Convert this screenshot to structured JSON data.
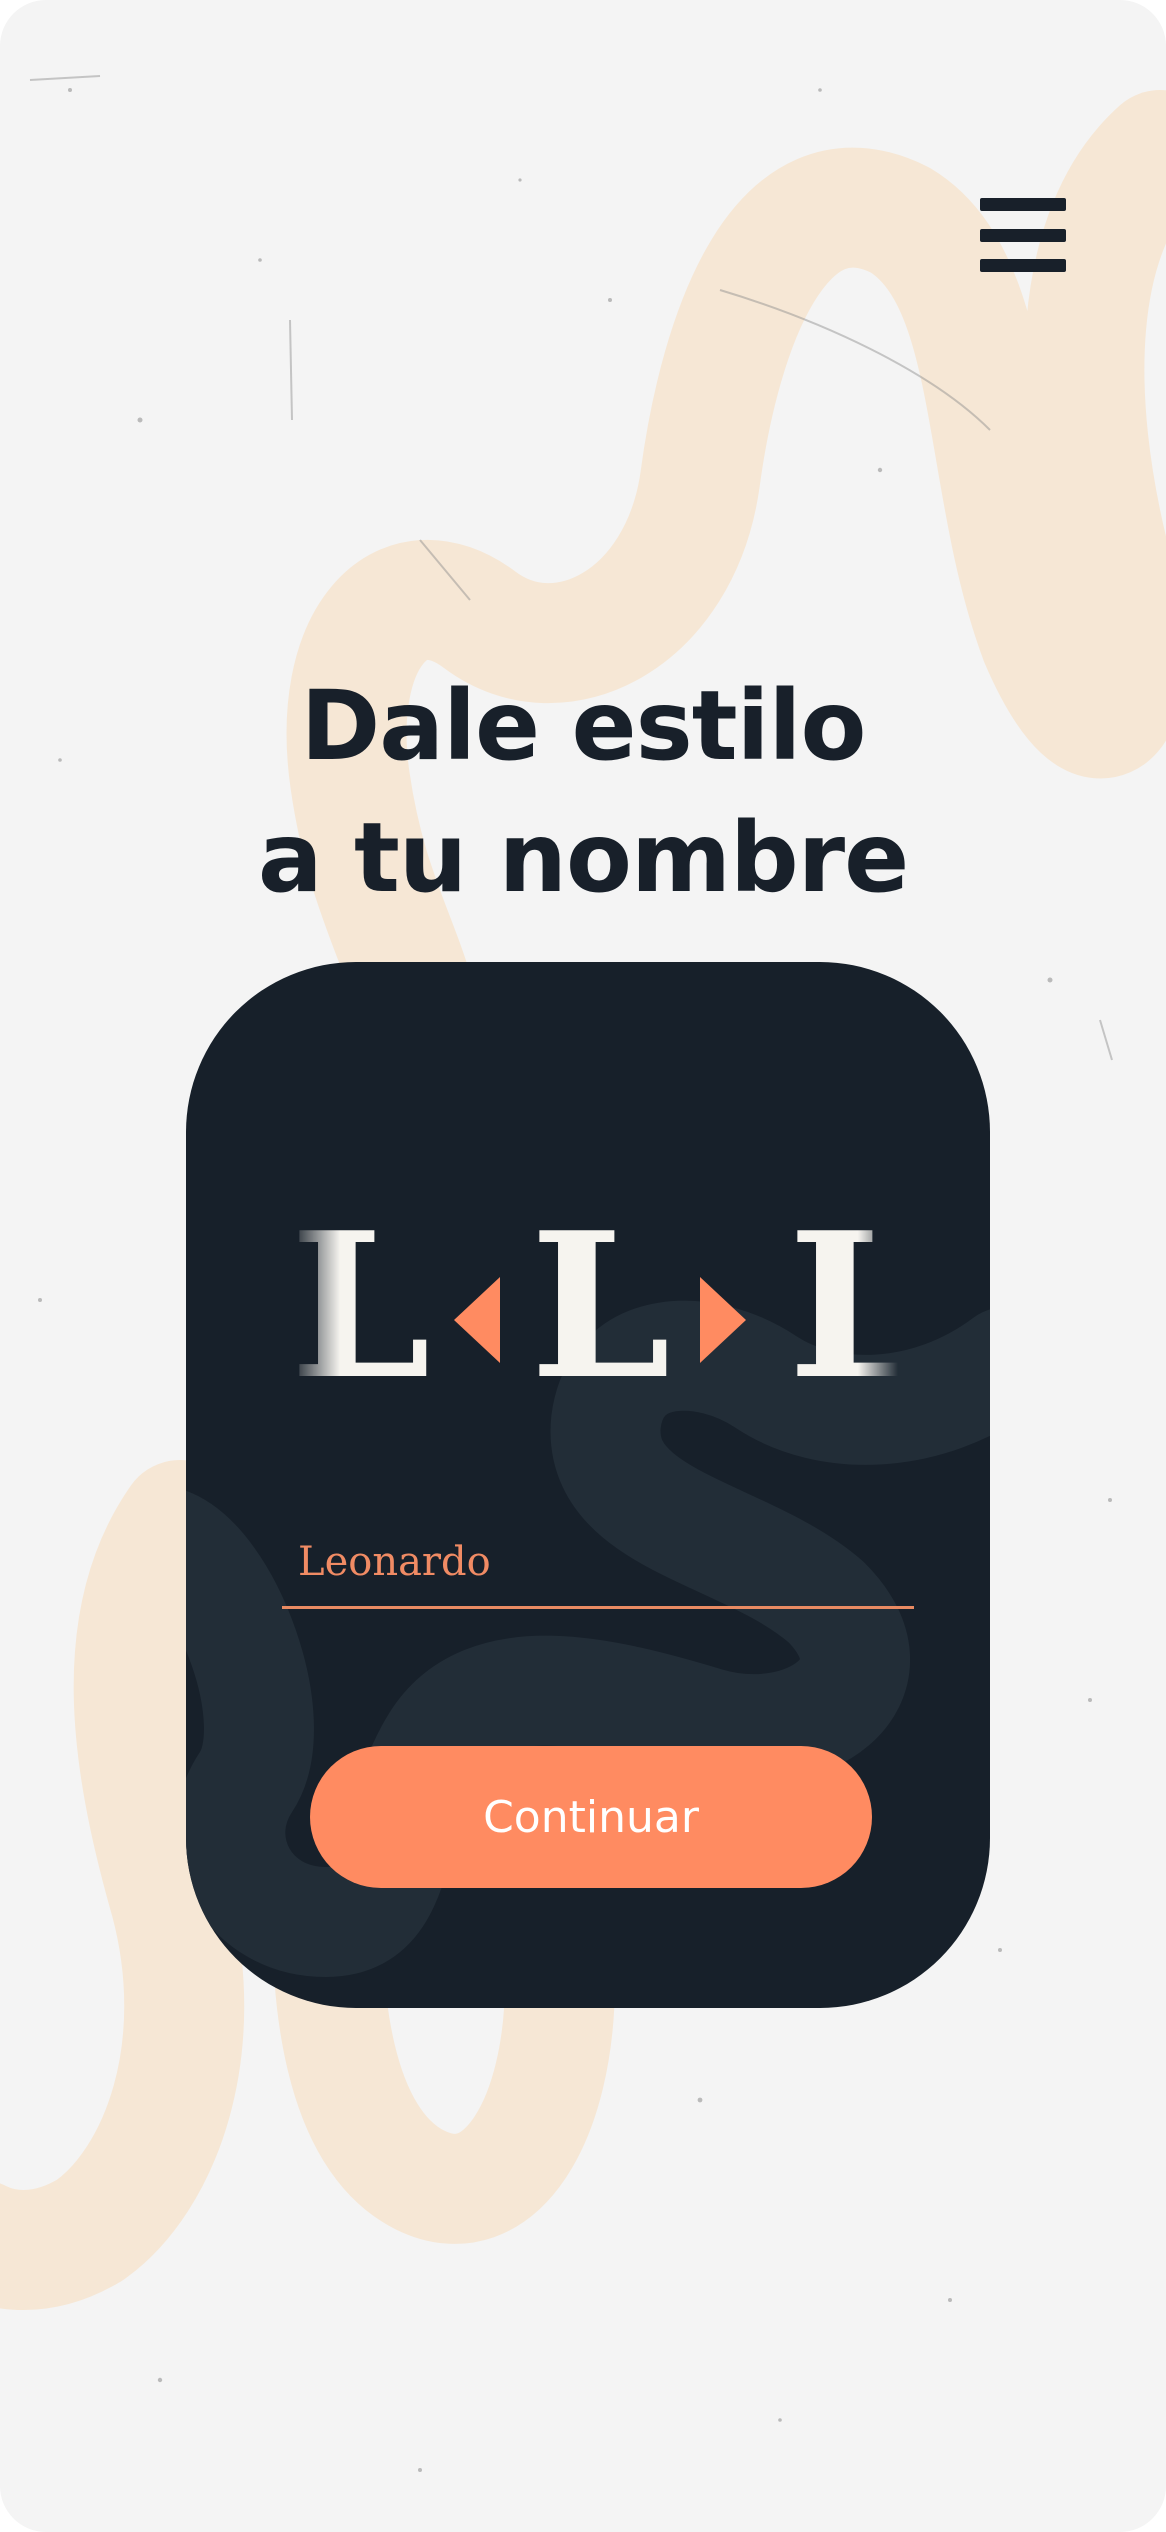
{
  "menu": {
    "icon": "hamburger-menu-icon"
  },
  "headline": {
    "line1": "Dale estilo",
    "line2": "a tu nombre"
  },
  "preview": {
    "letters": [
      "L",
      "L",
      "L"
    ],
    "prev_icon": "chevron-left-icon",
    "next_icon": "chevron-right-icon"
  },
  "name_field": {
    "value": "Leonardo"
  },
  "continue_button": {
    "label": "Continuar"
  },
  "colors": {
    "background": "#f4f4f4",
    "card": "#17202a",
    "text_dark": "#18202a",
    "accent": "#ff8b61",
    "squiggle": "#f6e7d5"
  }
}
